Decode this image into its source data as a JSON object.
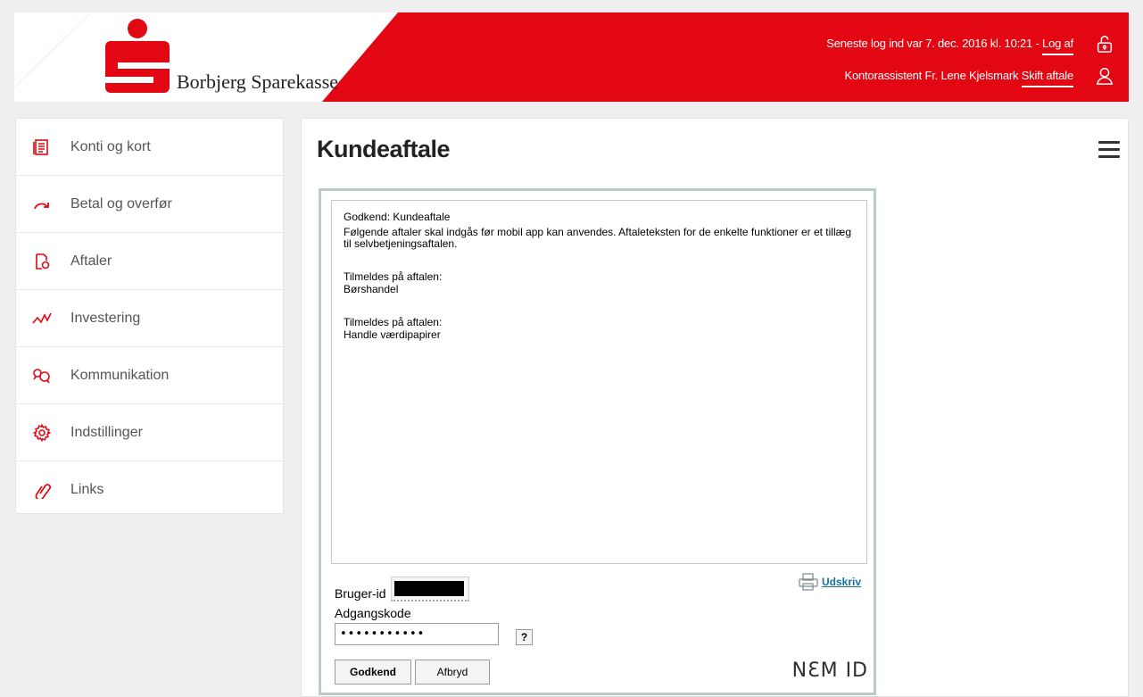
{
  "header": {
    "bank_name": "Borbjerg Sparekasse",
    "last_login_text": "Seneste log ind var 7. dec. 2016 kl. 10:21 -",
    "logout_label": "Log af",
    "user_text": "Kontorassistent Fr. Lene Kjelsmark",
    "switch_agreement_label": "Skift aftale",
    "logout_icon": "lock-icon",
    "user_icon": "user-icon",
    "brand_color": "#e30613"
  },
  "sidebar": {
    "items": [
      {
        "label": "Konti og kort",
        "icon": "account-card-icon"
      },
      {
        "label": "Betal og overfør",
        "icon": "transfer-arrow-icon"
      },
      {
        "label": "Aftaler",
        "icon": "agreement-icon"
      },
      {
        "label": "Investering",
        "icon": "investment-graph-icon"
      },
      {
        "label": "Kommunikation",
        "icon": "chat-icon"
      },
      {
        "label": "Indstillinger",
        "icon": "gear-icon"
      },
      {
        "label": "Links",
        "icon": "link-icon"
      }
    ]
  },
  "main": {
    "title": "Kundeaftale",
    "menu_icon": "hamburger-menu-icon"
  },
  "nemid": {
    "heading": "Godkend: Kundeaftale",
    "intro": "Følgende aftaler skal indgås før mobil app kan anvendes. Aftaleteksten for de enkelte funktioner er et tillæg til selvbetjeningsaftalen.",
    "agreements": [
      {
        "label": "Tilmeldes på aftalen:",
        "name": "Børshandel"
      },
      {
        "label": "Tilmeldes på aftalen:",
        "name": "Handle værdipapirer"
      }
    ],
    "print_label": "Udskriv",
    "userid_label": "Bruger-id",
    "password_label": "Adgangskode",
    "password_value": "•••••••••••",
    "help_label": "?",
    "approve_label": "Godkend",
    "cancel_label": "Afbryd",
    "logo_text": "NƐM ID"
  }
}
